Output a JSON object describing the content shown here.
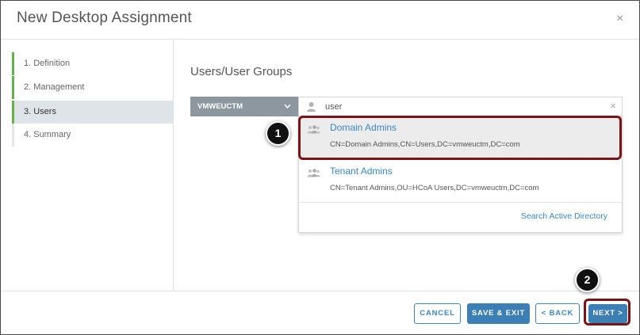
{
  "dialog": {
    "title": "New Desktop Assignment",
    "close_glyph": "×"
  },
  "sidebar": {
    "steps": [
      {
        "label": "1. Definition",
        "state": "complete"
      },
      {
        "label": "2. Management",
        "state": "complete"
      },
      {
        "label": "3. Users",
        "state": "active"
      },
      {
        "label": "4. Summary",
        "state": "pending"
      }
    ]
  },
  "main": {
    "section_title": "Users/User Groups",
    "domain": {
      "value": "VMWEUCTM",
      "icon": "chevron-down-icon"
    },
    "search": {
      "value": "user",
      "clear_glyph": "×",
      "icon": "user-icon"
    },
    "results": [
      {
        "name": "Domain Admins",
        "dn": "CN=Domain Admins,CN=Users,DC=vmweuctm,DC=com",
        "icon": "user-group-icon",
        "highlighted": true
      },
      {
        "name": "Tenant Admins",
        "dn": "CN=Tenant Admins,OU=HCoA Users,DC=vmweuctm,DC=com",
        "icon": "user-group-icon",
        "highlighted": false
      }
    ],
    "search_ad_label": "Search Active Directory"
  },
  "footer": {
    "cancel_label": "CANCEL",
    "save_exit_label": "SAVE & EXIT",
    "back_label": "< BACK",
    "next_label": "NEXT >"
  },
  "annotations": {
    "step1": "1",
    "step2": "2"
  },
  "colors": {
    "accent_blue": "#3b87c4",
    "primary_button": "#3b7fb5",
    "step_complete": "#65b14c",
    "callout_border": "#7a1416",
    "domain_select_bg": "#8c97a0"
  }
}
